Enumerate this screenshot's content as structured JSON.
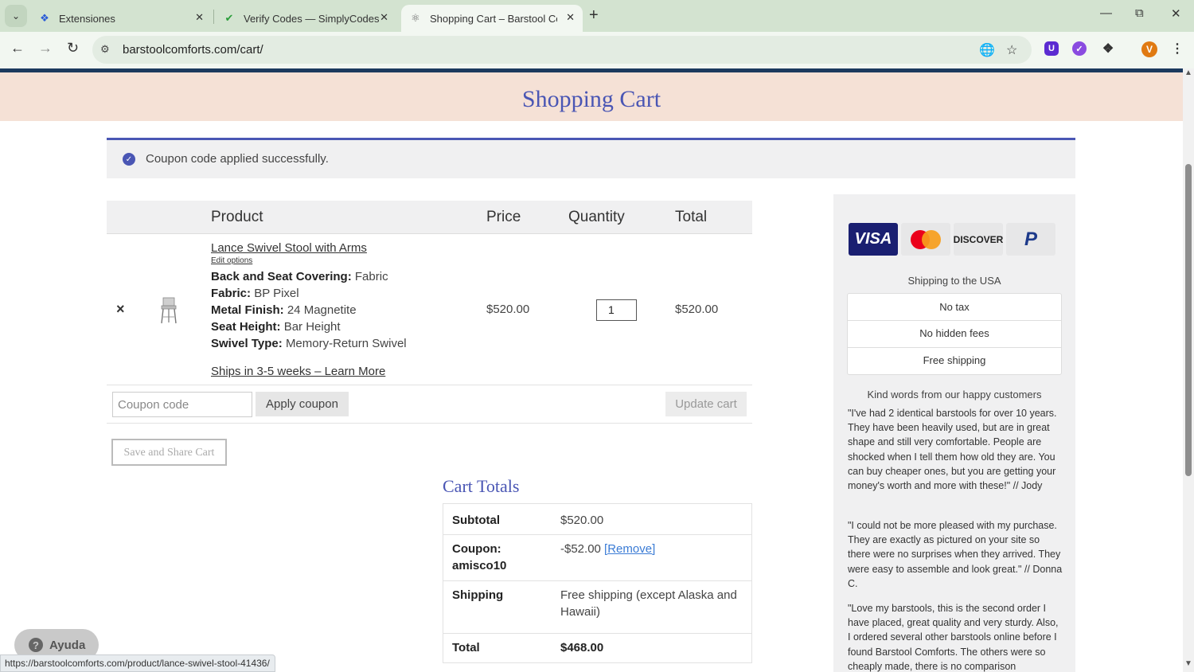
{
  "browser": {
    "tabs": [
      {
        "title": "Extensiones",
        "icon": "puzzle-icon"
      },
      {
        "title": "Verify Codes — SimplyCodes",
        "icon": "simplycodes-icon"
      },
      {
        "title": "Shopping Cart – Barstool Comfo",
        "icon": "barstool-icon",
        "active": true
      }
    ],
    "url": "barstoolcomforts.com/cart/",
    "profile_initial": "V",
    "status_url": "https://barstoolcomforts.com/product/lance-swivel-stool-41436/"
  },
  "page": {
    "title": "Shopping Cart",
    "notice": "Coupon code applied successfully."
  },
  "cart": {
    "headers": {
      "product": "Product",
      "price": "Price",
      "quantity": "Quantity",
      "total": "Total"
    },
    "item": {
      "name": "Lance Swivel Stool with Arms",
      "edit_options": "Edit options",
      "attributes": [
        {
          "label": "Back and Seat Covering:",
          "value": "Fabric"
        },
        {
          "label": "Fabric:",
          "value": "BP Pixel"
        },
        {
          "label": "Metal Finish:",
          "value": "24 Magnetite"
        },
        {
          "label": "Seat Height:",
          "value": "Bar Height"
        },
        {
          "label": "Swivel Type:",
          "value": "Memory-Return Swivel"
        }
      ],
      "shipping_note": "Ships in 3-5 weeks – Learn More",
      "price": "$520.00",
      "quantity": "1",
      "total": "$520.00",
      "remove": "×"
    },
    "coupon_placeholder": "Coupon code",
    "apply_coupon": "Apply coupon",
    "update_cart": "Update cart",
    "save_share": "Save and Share Cart"
  },
  "totals": {
    "title": "Cart Totals",
    "subtotal_label": "Subtotal",
    "subtotal": "$520.00",
    "coupon_label": "Coupon: amisco10",
    "coupon_value": "-$52.00",
    "coupon_remove": "[Remove]",
    "shipping_label": "Shipping",
    "shipping_value": "Free shipping (except Alaska and Hawaii)",
    "total_label": "Total",
    "total": "$468.00"
  },
  "sidebar": {
    "cards": [
      "VISA",
      "DISCOVER",
      "P"
    ],
    "shipping_to": "Shipping to the USA",
    "features": [
      "No tax",
      "No hidden fees",
      "Free shipping"
    ],
    "kind_words": "Kind words from our happy customers",
    "reviews": [
      "\"I've had 2 identical barstools for over 10 years. They have been heavily used, but are in great shape and still very comfortable. People are shocked when I tell them how old they are. You can buy cheaper ones, but you are getting your money's worth and more with these!\" // Jody",
      "\"I could not be more pleased with my purchase. They are exactly as pictured on your site so there were no surprises when they arrived. They were easy to assemble and look great.\" // Donna C.",
      "\"Love my barstools, this is the second order I have placed, great quality and very sturdy. Also, I ordered several other barstools online before I found Barstool Comforts. The others were so cheaply made, there is no comparison"
    ]
  },
  "help": {
    "label": "Ayuda"
  },
  "colors": {
    "accent": "#4a56b4",
    "header_band": "#f5e1d6",
    "tab_bar": "#d3e3d0"
  }
}
